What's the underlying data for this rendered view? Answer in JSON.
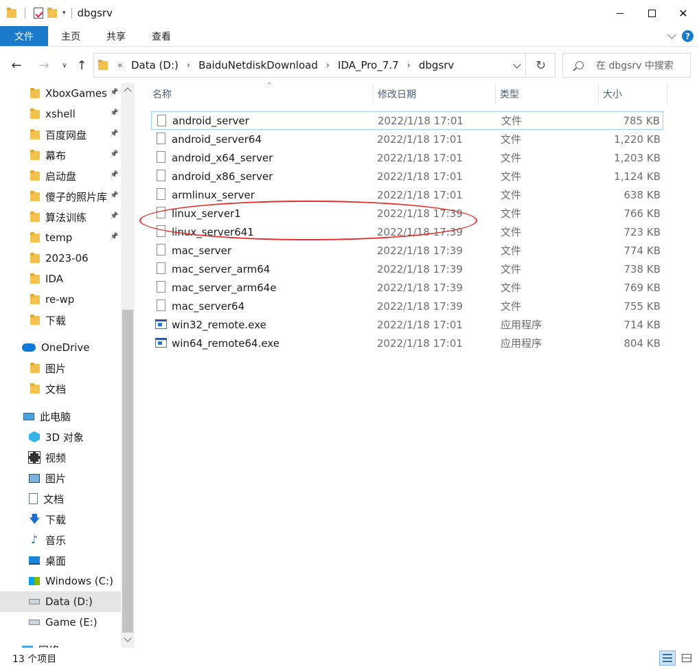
{
  "window": {
    "title": "dbgsrv"
  },
  "ribbon": {
    "tabs": [
      "文件",
      "主页",
      "共享",
      "查看"
    ]
  },
  "address": {
    "lead": "«",
    "crumbs": [
      "Data (D:)",
      "BaiduNetdiskDownload",
      "IDA_Pro_7.7",
      "dbgsrv"
    ],
    "separator": "›"
  },
  "search": {
    "placeholder": "在 dbgsrv 中搜索"
  },
  "sidebar": {
    "quick_access": [
      {
        "label": "XboxGames",
        "pinned": true
      },
      {
        "label": "xshell",
        "pinned": true
      },
      {
        "label": "百度网盘",
        "pinned": true
      },
      {
        "label": "幕布",
        "pinned": true
      },
      {
        "label": "启动盘",
        "pinned": true
      },
      {
        "label": "傻子的照片库",
        "pinned": true
      },
      {
        "label": "算法训练",
        "pinned": true
      },
      {
        "label": "temp",
        "pinned": true
      },
      {
        "label": "2023-06",
        "pinned": false
      },
      {
        "label": "IDA",
        "pinned": false
      },
      {
        "label": "re-wp",
        "pinned": false
      },
      {
        "label": "下载",
        "pinned": false
      }
    ],
    "onedrive": {
      "label": "OneDrive",
      "items": [
        "图片",
        "文档"
      ]
    },
    "this_pc": {
      "label": "此电脑",
      "items": [
        {
          "label": "3D 对象",
          "icon": "cube-icon"
        },
        {
          "label": "视频",
          "icon": "video-icon"
        },
        {
          "label": "图片",
          "icon": "pictures-icon"
        },
        {
          "label": "文档",
          "icon": "documents-icon"
        },
        {
          "label": "下载",
          "icon": "download-icon"
        },
        {
          "label": "音乐",
          "icon": "music-icon"
        },
        {
          "label": "桌面",
          "icon": "desktop-icon"
        },
        {
          "label": "Windows (C:)",
          "icon": "windows-drive-icon"
        },
        {
          "label": "Data (D:)",
          "icon": "drive-icon",
          "selected": true
        },
        {
          "label": "Game (E:)",
          "icon": "drive-icon"
        }
      ]
    },
    "network": {
      "label": "网络"
    }
  },
  "columns": {
    "name": "名称",
    "date": "修改日期",
    "type": "类型",
    "size": "大小"
  },
  "files": [
    {
      "name": "android_server",
      "date": "2022/1/18 17:01",
      "type": "文件",
      "size": "785 KB",
      "kind": "file"
    },
    {
      "name": "android_server64",
      "date": "2022/1/18 17:01",
      "type": "文件",
      "size": "1,220 KB",
      "kind": "file"
    },
    {
      "name": "android_x64_server",
      "date": "2022/1/18 17:01",
      "type": "文件",
      "size": "1,203 KB",
      "kind": "file"
    },
    {
      "name": "android_x86_server",
      "date": "2022/1/18 17:01",
      "type": "文件",
      "size": "1,124 KB",
      "kind": "file"
    },
    {
      "name": "armlinux_server",
      "date": "2022/1/18 17:01",
      "type": "文件",
      "size": "638 KB",
      "kind": "file"
    },
    {
      "name": "linux_server1",
      "date": "2022/1/18 17:39",
      "type": "文件",
      "size": "766 KB",
      "kind": "file"
    },
    {
      "name": "linux_server641",
      "date": "2022/1/18 17:39",
      "type": "文件",
      "size": "723 KB",
      "kind": "file"
    },
    {
      "name": "mac_server",
      "date": "2022/1/18 17:39",
      "type": "文件",
      "size": "774 KB",
      "kind": "file"
    },
    {
      "name": "mac_server_arm64",
      "date": "2022/1/18 17:39",
      "type": "文件",
      "size": "738 KB",
      "kind": "file"
    },
    {
      "name": "mac_server_arm64e",
      "date": "2022/1/18 17:39",
      "type": "文件",
      "size": "769 KB",
      "kind": "file"
    },
    {
      "name": "mac_server64",
      "date": "2022/1/18 17:39",
      "type": "文件",
      "size": "755 KB",
      "kind": "file"
    },
    {
      "name": "win32_remote.exe",
      "date": "2022/1/18 17:01",
      "type": "应用程序",
      "size": "714 KB",
      "kind": "exe"
    },
    {
      "name": "win64_remote64.exe",
      "date": "2022/1/18 17:01",
      "type": "应用程序",
      "size": "804 KB",
      "kind": "exe"
    }
  ],
  "status": {
    "item_count": "13 个项目"
  },
  "colors": {
    "accent": "#1979ca",
    "annotation": "#e0302c",
    "selection": "#e5e5e5"
  }
}
